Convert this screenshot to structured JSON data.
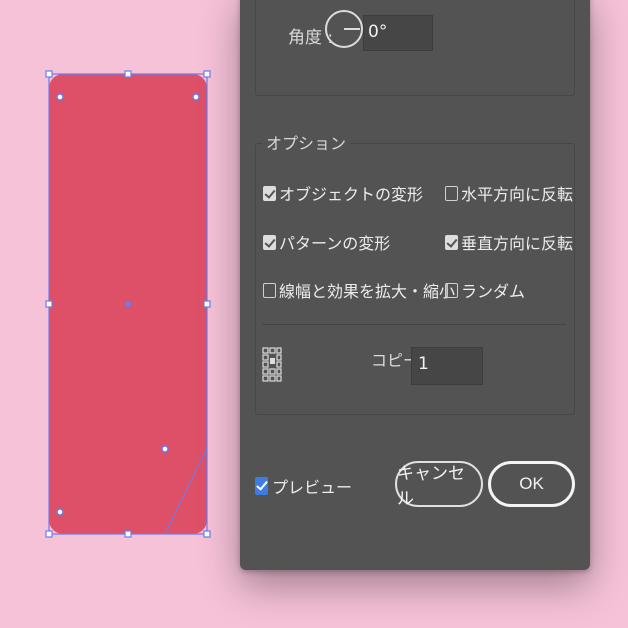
{
  "angle": {
    "label": "角度 :",
    "value": "0°"
  },
  "options": {
    "legend": "オプション",
    "transform_object": {
      "label": "オブジェクトの変形",
      "checked": true
    },
    "flip_horizontal": {
      "label": "水平方向に反転",
      "checked": false
    },
    "transform_pattern": {
      "label": "パターンの変形",
      "checked": true
    },
    "flip_vertical": {
      "label": "垂直方向に反転",
      "checked": true
    },
    "scale_strokes": {
      "label": "線幅と効果を拡大・縮小",
      "checked": false
    },
    "random": {
      "label": "ランダム",
      "checked": false
    }
  },
  "copies": {
    "label": "コピー",
    "value": "1"
  },
  "preview": {
    "label": "プレビュー",
    "checked": true
  },
  "buttons": {
    "cancel": "キャンセル",
    "ok": "OK"
  },
  "colors": {
    "background": "#f6c2d8",
    "shape_fill": "#dd5068",
    "selection": "#6a7cf0",
    "dialog": "#535353"
  }
}
